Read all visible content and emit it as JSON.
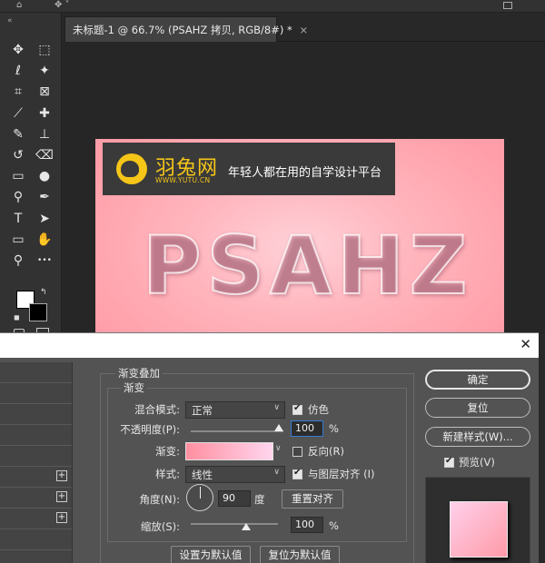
{
  "document_tab": {
    "title": "未标题-1 @ 66.7% (PSAHZ 拷贝, RGB/8#) *",
    "close": "×"
  },
  "canvas": {
    "brand_name": "羽兔网",
    "brand_url": "WWW.YUTU.CN",
    "slogan": "年轻人都在用的自学设计平台",
    "headline": "PSAHZ"
  },
  "tools": [
    {
      "name": "move-icon",
      "glyph": "✥"
    },
    {
      "name": "marquee-icon",
      "glyph": "⬚"
    },
    {
      "name": "lasso-icon",
      "glyph": "ℓ"
    },
    {
      "name": "magic-wand-icon",
      "glyph": "✦"
    },
    {
      "name": "crop-icon",
      "glyph": "⌗"
    },
    {
      "name": "frame-icon",
      "glyph": "⊠"
    },
    {
      "name": "eyedropper-icon",
      "glyph": "⟋"
    },
    {
      "name": "healing-brush-icon",
      "glyph": "✚"
    },
    {
      "name": "brush-icon",
      "glyph": "✎"
    },
    {
      "name": "stamp-icon",
      "glyph": "⊥"
    },
    {
      "name": "history-brush-icon",
      "glyph": "↺"
    },
    {
      "name": "eraser-icon",
      "glyph": "⌫"
    },
    {
      "name": "gradient-icon",
      "glyph": "▭"
    },
    {
      "name": "blur-icon",
      "glyph": "●"
    },
    {
      "name": "dodge-icon",
      "glyph": "⚲"
    },
    {
      "name": "pen-icon",
      "glyph": "✒"
    },
    {
      "name": "type-icon",
      "glyph": "T"
    },
    {
      "name": "path-select-icon",
      "glyph": "➤"
    },
    {
      "name": "shape-icon",
      "glyph": "▭"
    },
    {
      "name": "hand-icon",
      "glyph": "✋"
    },
    {
      "name": "zoom-icon",
      "glyph": "⚲"
    },
    {
      "name": "more-tools-icon",
      "glyph": "•••"
    }
  ],
  "dialog": {
    "close": "✕",
    "section_title": "渐变叠加",
    "subsection_title": "渐变",
    "blend_mode": {
      "label": "混合模式:",
      "value": "正常"
    },
    "dither": {
      "label": "仿色",
      "checked": true
    },
    "opacity": {
      "label": "不透明度(P):",
      "value": "100",
      "unit": "%",
      "level": 1.0
    },
    "gradient": {
      "label": "渐变:",
      "colors": [
        "#ff8fa0",
        "#ffd6ee"
      ]
    },
    "reverse": {
      "label": "反向(R)",
      "checked": false
    },
    "style": {
      "label": "样式:",
      "value": "线性"
    },
    "align_with_layer": {
      "label": "与图层对齐 (I)",
      "checked": true
    },
    "angle": {
      "label": "角度(N):",
      "value": "90",
      "unit": "度"
    },
    "reset_alignment": "重置对齐",
    "scale": {
      "label": "缩放(S):",
      "value": "100",
      "unit": "%",
      "level": 0.5
    },
    "make_default": "设置为默认值",
    "reset_to_default": "复位为默认值",
    "ok": "确定",
    "reset": "复位",
    "new_style": "新建样式(W)...",
    "preview": {
      "label": "预览(V)",
      "checked": true
    },
    "left_list_plus": [
      "+",
      "+",
      "+"
    ]
  }
}
